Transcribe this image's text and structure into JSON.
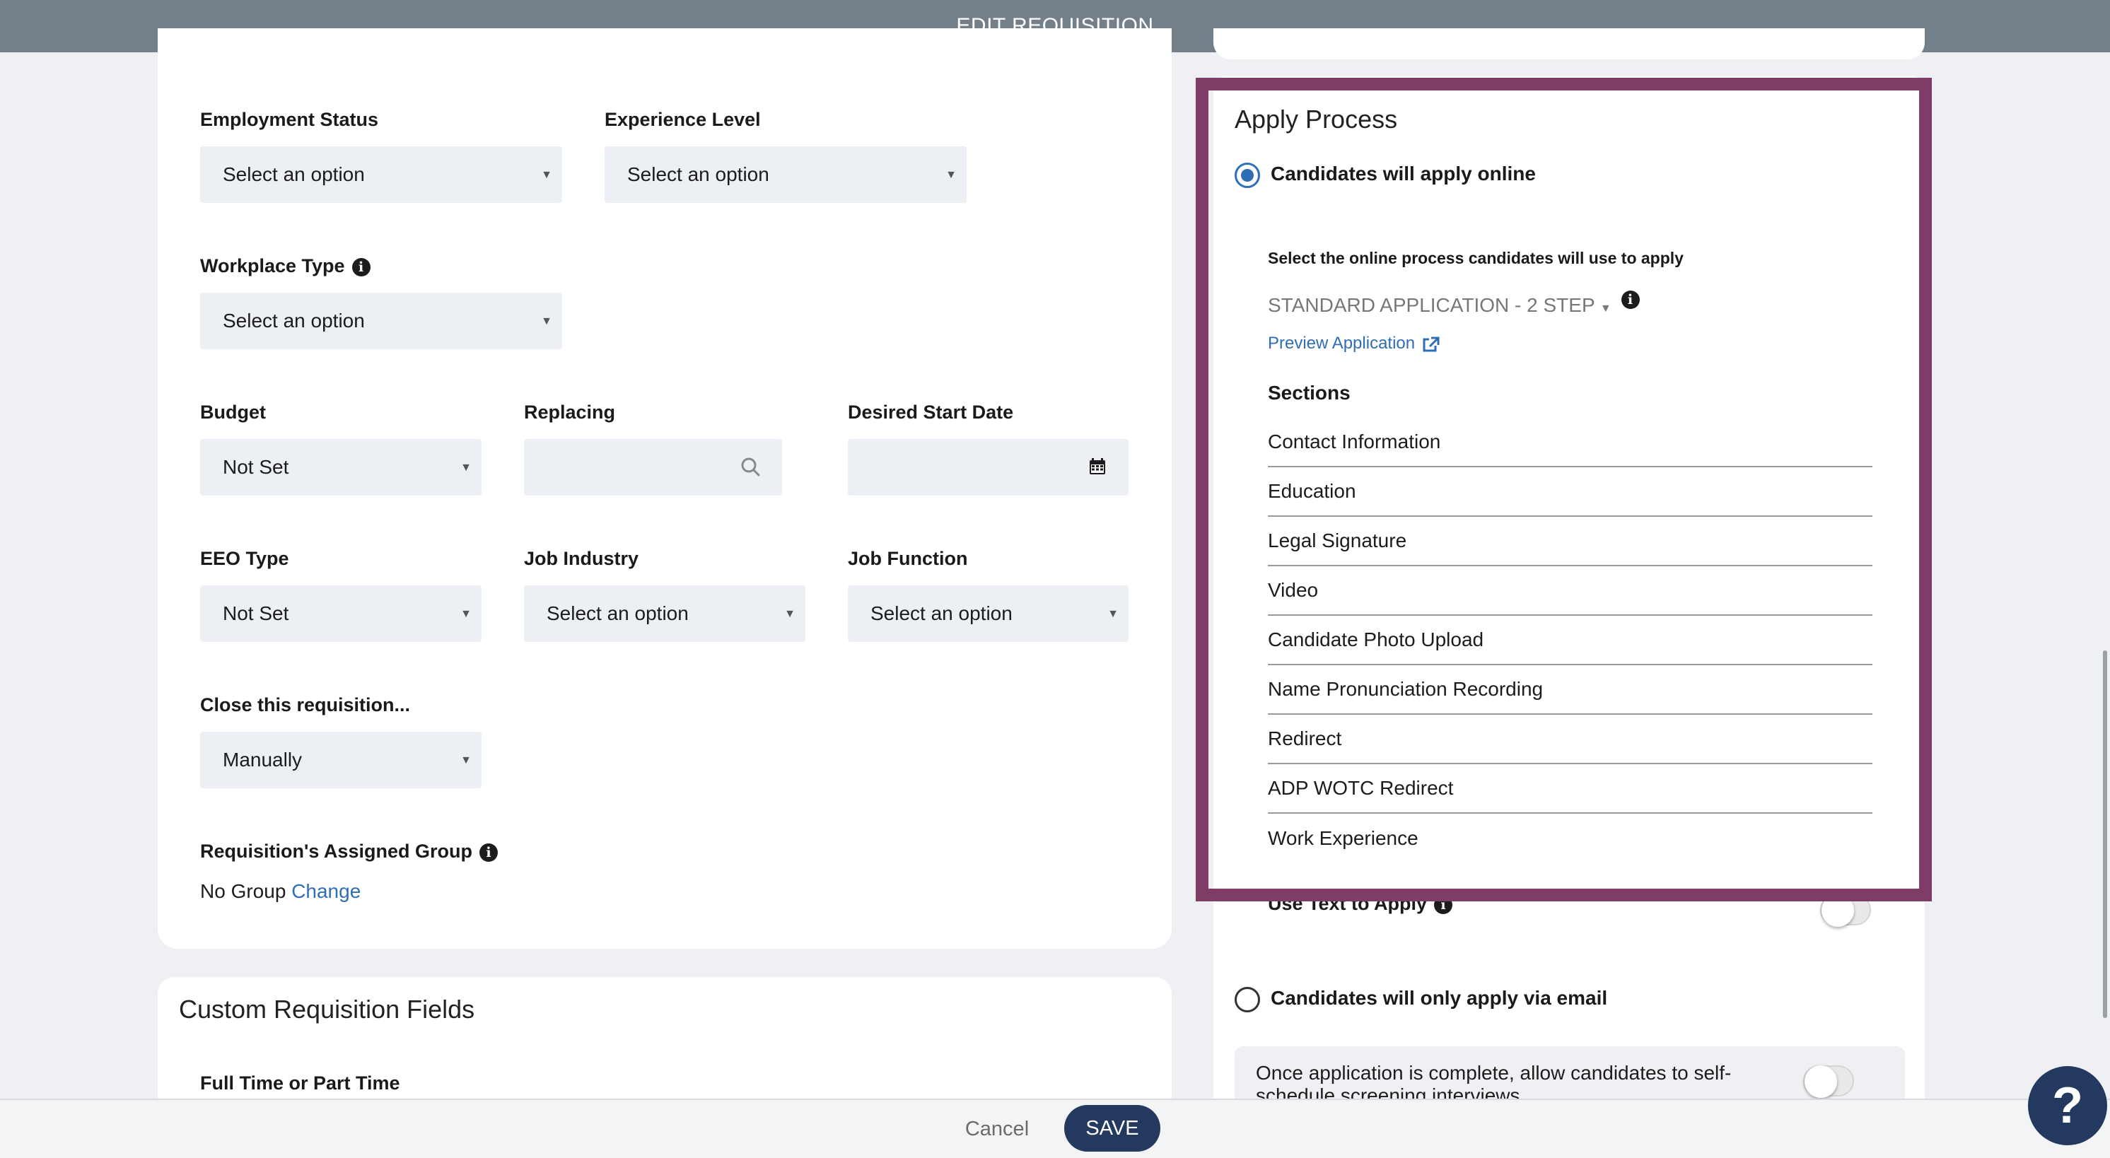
{
  "header": {
    "title": "EDIT REQUISITION"
  },
  "form": {
    "employment_status": {
      "label": "Employment Status",
      "value": "Select an option"
    },
    "experience_level": {
      "label": "Experience Level",
      "value": "Select an option"
    },
    "workplace_type": {
      "label": "Workplace Type",
      "value": "Select an option"
    },
    "budget": {
      "label": "Budget",
      "value": "Not Set"
    },
    "replacing": {
      "label": "Replacing",
      "value": ""
    },
    "desired_start_date": {
      "label": "Desired Start Date",
      "value": ""
    },
    "eeo_type": {
      "label": "EEO Type",
      "value": "Not Set"
    },
    "job_industry": {
      "label": "Job Industry",
      "value": "Select an option"
    },
    "job_function": {
      "label": "Job Function",
      "value": "Select an option"
    },
    "close_requisition": {
      "label": "Close this requisition...",
      "value": "Manually"
    },
    "assigned_group": {
      "label": "Requisition's Assigned Group",
      "value": "No Group",
      "change_link": "Change"
    }
  },
  "custom_fields": {
    "title": "Custom Requisition Fields",
    "first_field_label": "Full Time or Part Time"
  },
  "apply_process": {
    "title": "Apply Process",
    "online_option": "Candidates will apply online",
    "online_selected": true,
    "process_label": "Select the online process candidates will use to apply",
    "process_value": "STANDARD APPLICATION - 2 STEP",
    "preview_link": "Preview Application",
    "sections_title": "Sections",
    "sections": [
      "Contact Information",
      "Education",
      "Legal Signature",
      "Video",
      "Candidate Photo Upload",
      "Name Pronunciation Recording",
      "Redirect",
      "ADP WOTC Redirect",
      "Work Experience"
    ],
    "text_to_apply_label": "Use Text to Apply",
    "email_option": "Candidates will only apply via email",
    "email_selected": false,
    "self_schedule_text": "Once application is complete, allow candidates to self-schedule screening interviews"
  },
  "footer": {
    "cancel_label": "Cancel",
    "save_label": "SAVE"
  },
  "help": {
    "label": "?"
  },
  "colors": {
    "header_bg": "#737f89",
    "highlight_border": "#7e3c66",
    "save_bg": "#24395f",
    "link": "#2f6eb5"
  }
}
